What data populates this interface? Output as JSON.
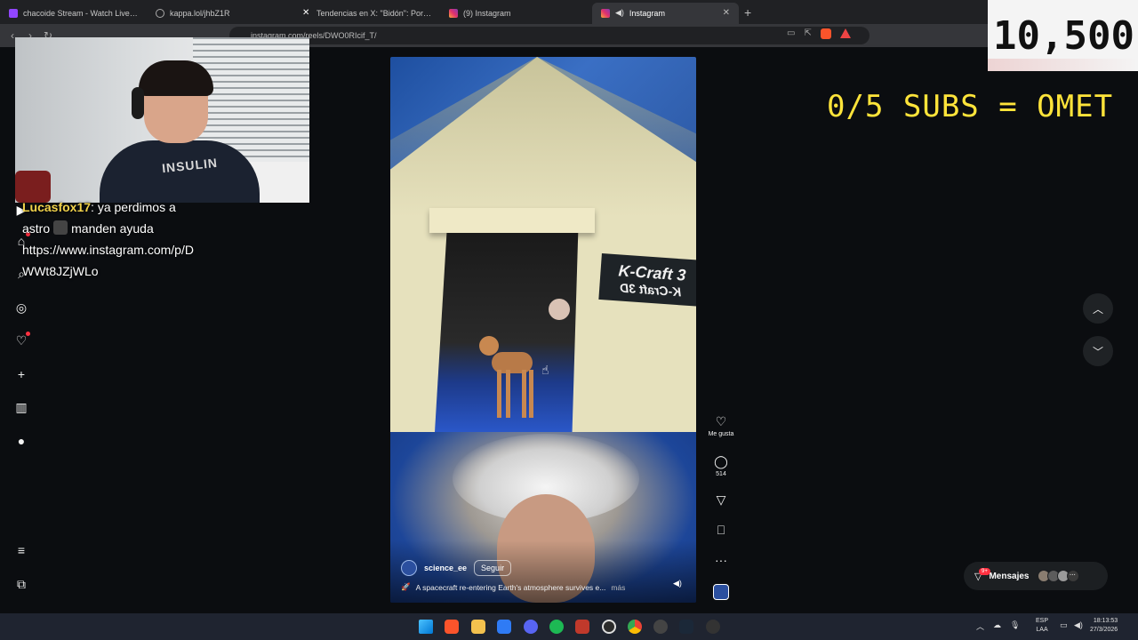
{
  "browser": {
    "tabs": [
      {
        "title": "chacoide Stream - Watch Live on",
        "color": "#9146ff",
        "active": false
      },
      {
        "title": "kappa.lol/jhbZ1R",
        "color": "#888888",
        "active": false
      },
      {
        "title": "Tendencias en X: \"Bidón\": Por este g",
        "color": "#111111",
        "active": false
      },
      {
        "title": "(9) Instagram",
        "color": "#e1306c",
        "active": false
      },
      {
        "title": "Instagram",
        "color": "#e1306c",
        "active": true
      }
    ],
    "new_tab": "+",
    "url": "instagram.com/reels/DWO0RIcif_T/"
  },
  "overlay": {
    "counter": "10,500",
    "sub_goal": "0/5 SUBS = OMET"
  },
  "chat": {
    "username": "Lucasfox17",
    "line1_rest": ": ya perdimos a",
    "line2_a": "astro",
    "line2_b": "manden ayuda",
    "link_line1": "https://www.instagram.com/p/D",
    "link_line2": "WWt8JZjWLo"
  },
  "webcam": {
    "shirt_text": "INSULIN"
  },
  "reel": {
    "sign_text_1": "K-Craft 3",
    "sign_text_2": "K-Craft 3D",
    "author": "science_ee",
    "follow_label": "Seguir",
    "caption": "A spacecraft re-entering Earth's atmosphere survives e...",
    "caption_more": "más"
  },
  "actions": {
    "like_label": "Me gusta",
    "comments_count": "514"
  },
  "messages": {
    "label": "Mensajes",
    "badge": "9+"
  },
  "taskbar": {
    "lang_top": "ESP",
    "lang_bottom": "LAA",
    "time": "18:13:53",
    "date": "27/3/2026"
  },
  "icons": [
    "home-icon",
    "search-icon",
    "explore-icon",
    "heart-icon",
    "create-icon",
    "insights-icon",
    "profile-icon",
    "menu-icon",
    "more-apps-icon",
    "chevron-up-icon",
    "chevron-down-icon",
    "comment-icon",
    "share-icon",
    "bookmark-icon",
    "more-icon"
  ]
}
